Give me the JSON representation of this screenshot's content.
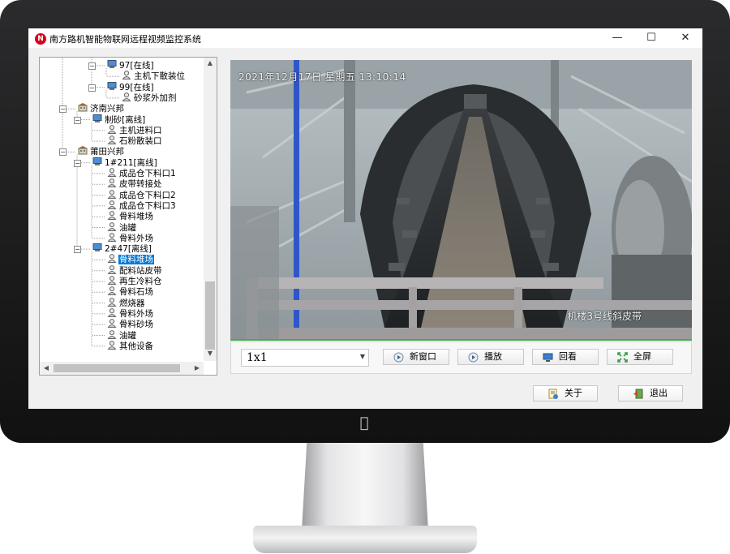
{
  "window": {
    "title": "南方路机智能物联网远程视频监控系统",
    "logo_text": "N",
    "minimize": "—",
    "maximize": "☐",
    "close": "✕"
  },
  "tree": {
    "nodes": [
      {
        "label": "97[在线]",
        "type": "dvr"
      },
      {
        "label": "主机下散装位",
        "type": "camera"
      },
      {
        "label": "99[在线]",
        "type": "dvr"
      },
      {
        "label": "砂浆外加剂",
        "type": "camera"
      },
      {
        "label": "济南兴邦",
        "type": "site"
      },
      {
        "label": "制砂[离线]",
        "type": "dvr"
      },
      {
        "label": "主机进料口",
        "type": "camera"
      },
      {
        "label": "石粉散装口",
        "type": "camera"
      },
      {
        "label": "莆田兴邦",
        "type": "site"
      },
      {
        "label": "1#211[离线]",
        "type": "dvr"
      },
      {
        "label": "成品仓下料口1",
        "type": "camera"
      },
      {
        "label": "皮带转接处",
        "type": "camera"
      },
      {
        "label": "成品仓下料口2",
        "type": "camera"
      },
      {
        "label": "成品仓下料口3",
        "type": "camera"
      },
      {
        "label": "骨料堆场",
        "type": "camera"
      },
      {
        "label": "油罐",
        "type": "camera"
      },
      {
        "label": "骨料外场",
        "type": "camera"
      },
      {
        "label": "2#47[离线]",
        "type": "dvr"
      },
      {
        "label": "骨料堆场",
        "type": "camera",
        "selected": true
      },
      {
        "label": "配料站皮带",
        "type": "camera"
      },
      {
        "label": "再生冷料仓",
        "type": "camera"
      },
      {
        "label": "骨料石场",
        "type": "camera"
      },
      {
        "label": "燃烧器",
        "type": "camera"
      },
      {
        "label": "骨料外场",
        "type": "camera"
      },
      {
        "label": "骨料砂场",
        "type": "camera"
      },
      {
        "label": "油罐",
        "type": "camera"
      },
      {
        "label": "其他设备",
        "type": "camera"
      }
    ]
  },
  "video": {
    "timestamp": "2021年12月17日  星期五  13:10:14",
    "channel_name": "机楼3号线斜皮带"
  },
  "controls": {
    "layout_value": "1x1",
    "new_window": "新窗口",
    "play": "播放",
    "playback": "回看",
    "fullscreen": "全屏"
  },
  "footer": {
    "about": "关于",
    "exit": "退出"
  },
  "colors": {
    "selection": "#0078d7",
    "brand_red": "#d9001b"
  }
}
